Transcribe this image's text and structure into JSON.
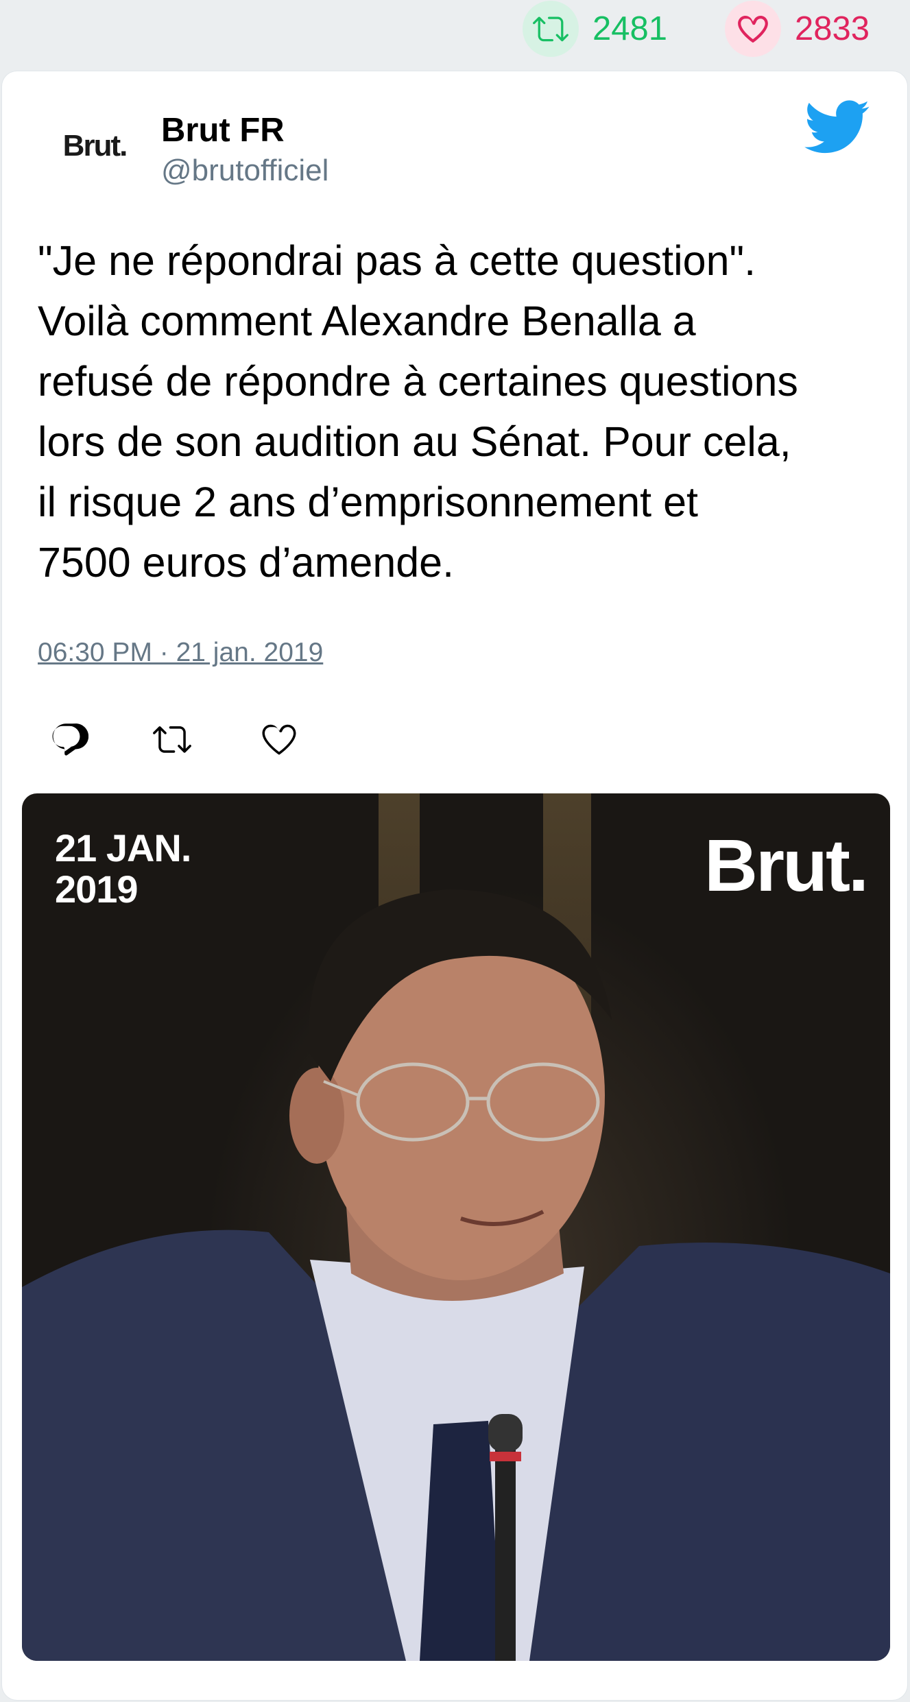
{
  "stats": {
    "retweets": "2481",
    "likes": "2833"
  },
  "author": {
    "avatar_text": "Brut.",
    "name": "Brut FR",
    "handle": "@brutofficiel"
  },
  "tweet": {
    "lines": [
      "\"Je ne répondrai pas à cette question\".",
      "Voilà comment Alexandre Benalla a",
      "refusé de répondre à certaines questions",
      "lors de son audition au Sénat. Pour cela,",
      "il risque 2 ans d’emprisonnement et",
      "7500 euros d’amende."
    ],
    "timestamp": "06:30 PM · 21 jan. 2019"
  },
  "media": {
    "date_line1": "21 JAN.",
    "date_line2": "2019",
    "logo": "Brut."
  },
  "colors": {
    "retweet": "#17bf63",
    "like": "#e0245e",
    "twitter_blue": "#1da1f2",
    "muted": "#657786"
  },
  "icons": [
    "retweet-icon",
    "heart-icon",
    "twitter-bird-icon",
    "reply-icon"
  ]
}
